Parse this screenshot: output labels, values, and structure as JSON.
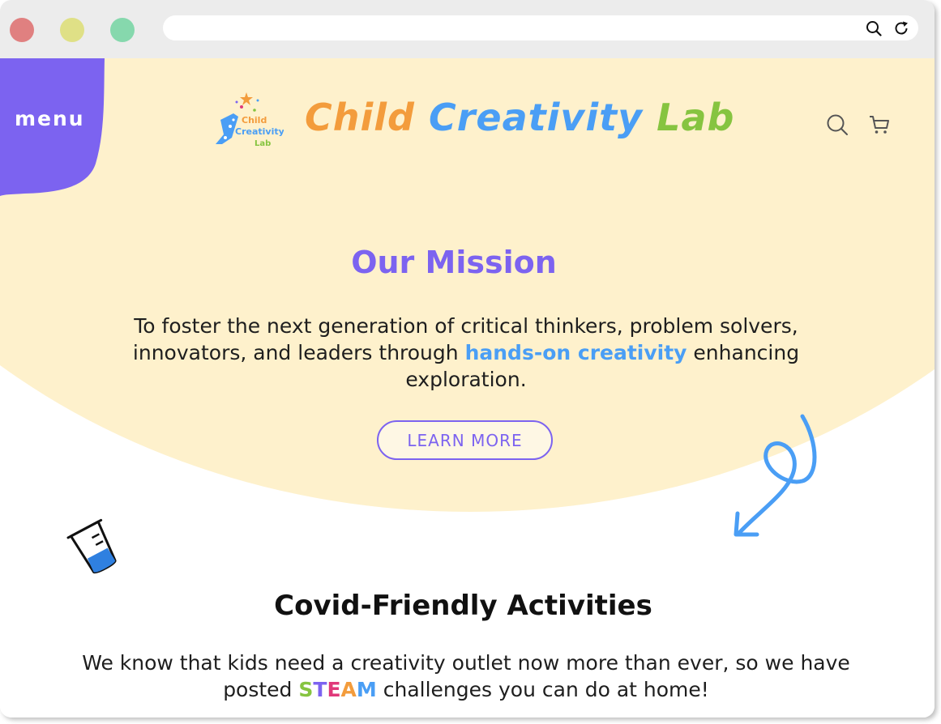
{
  "browser": {
    "window_controls": [
      "close",
      "minimize",
      "maximize"
    ],
    "url": "",
    "icons": [
      "search-icon",
      "reload-icon"
    ]
  },
  "header": {
    "menu_label": "menu",
    "logo_text": [
      "Child",
      "Creativity",
      "Lab"
    ],
    "title_parts": [
      {
        "text": "Child ",
        "color": "#f39c3c"
      },
      {
        "text": "Creativity ",
        "color": "#4a9ef5"
      },
      {
        "text": "Lab",
        "color": "#86c440"
      }
    ],
    "icons": [
      "search-icon",
      "cart-icon"
    ]
  },
  "mission": {
    "title": "Our Mission",
    "text_before": "To foster the next generation of critical thinkers, problem solvers, innovators, and leaders through ",
    "highlight": "hands-on creativity",
    "text_after": " enhancing exploration.",
    "button_label": "LEARN MORE"
  },
  "covid": {
    "title": "Covid-Friendly Activities",
    "text_before": "We know that kids need a creativity outlet now more than ever, so we have posted ",
    "steam_letters": [
      {
        "letter": "S",
        "color": "#86c440"
      },
      {
        "letter": "T",
        "color": "#7c63f0"
      },
      {
        "letter": "E",
        "color": "#e0397a"
      },
      {
        "letter": "A",
        "color": "#f39c3c"
      },
      {
        "letter": "M",
        "color": "#4a9ef5"
      }
    ],
    "text_after": " challenges you can do at home!"
  },
  "colors": {
    "accent_purple": "#7c63f0",
    "hero_background": "#fef1cc",
    "accent_blue": "#4a9ef5"
  }
}
